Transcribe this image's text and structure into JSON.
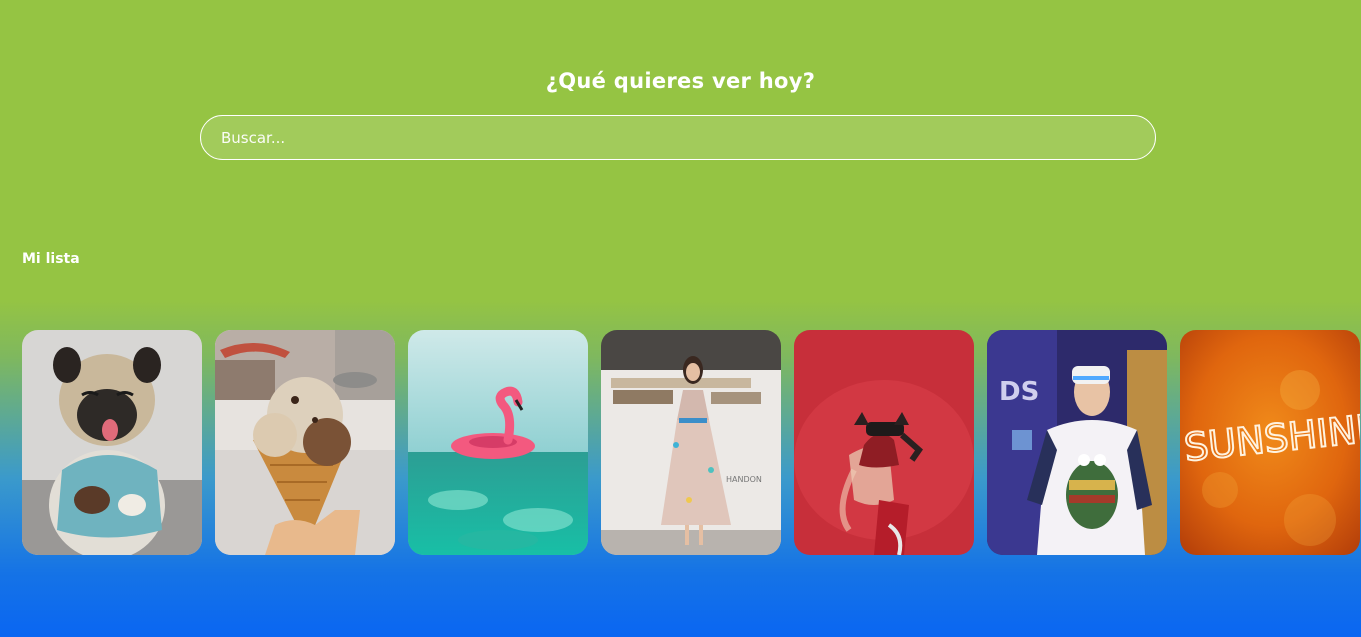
{
  "hero": {
    "title": "¿Qué quieres ver hoy?",
    "search_placeholder": "Buscar..."
  },
  "section": {
    "title": "Mi lista"
  },
  "cards": [
    {
      "subject": "pug"
    },
    {
      "subject": "ice-cream-cone"
    },
    {
      "subject": "flamingo-float"
    },
    {
      "subject": "woman-in-dress"
    },
    {
      "subject": "person-vr-red"
    },
    {
      "subject": "boy-vr-headset"
    },
    {
      "subject": "sunshine-graffiti",
      "text": "SUNSHINE"
    }
  ],
  "colors": {
    "top_green": "#95c443",
    "bottom_blue": "#0a66f2"
  }
}
